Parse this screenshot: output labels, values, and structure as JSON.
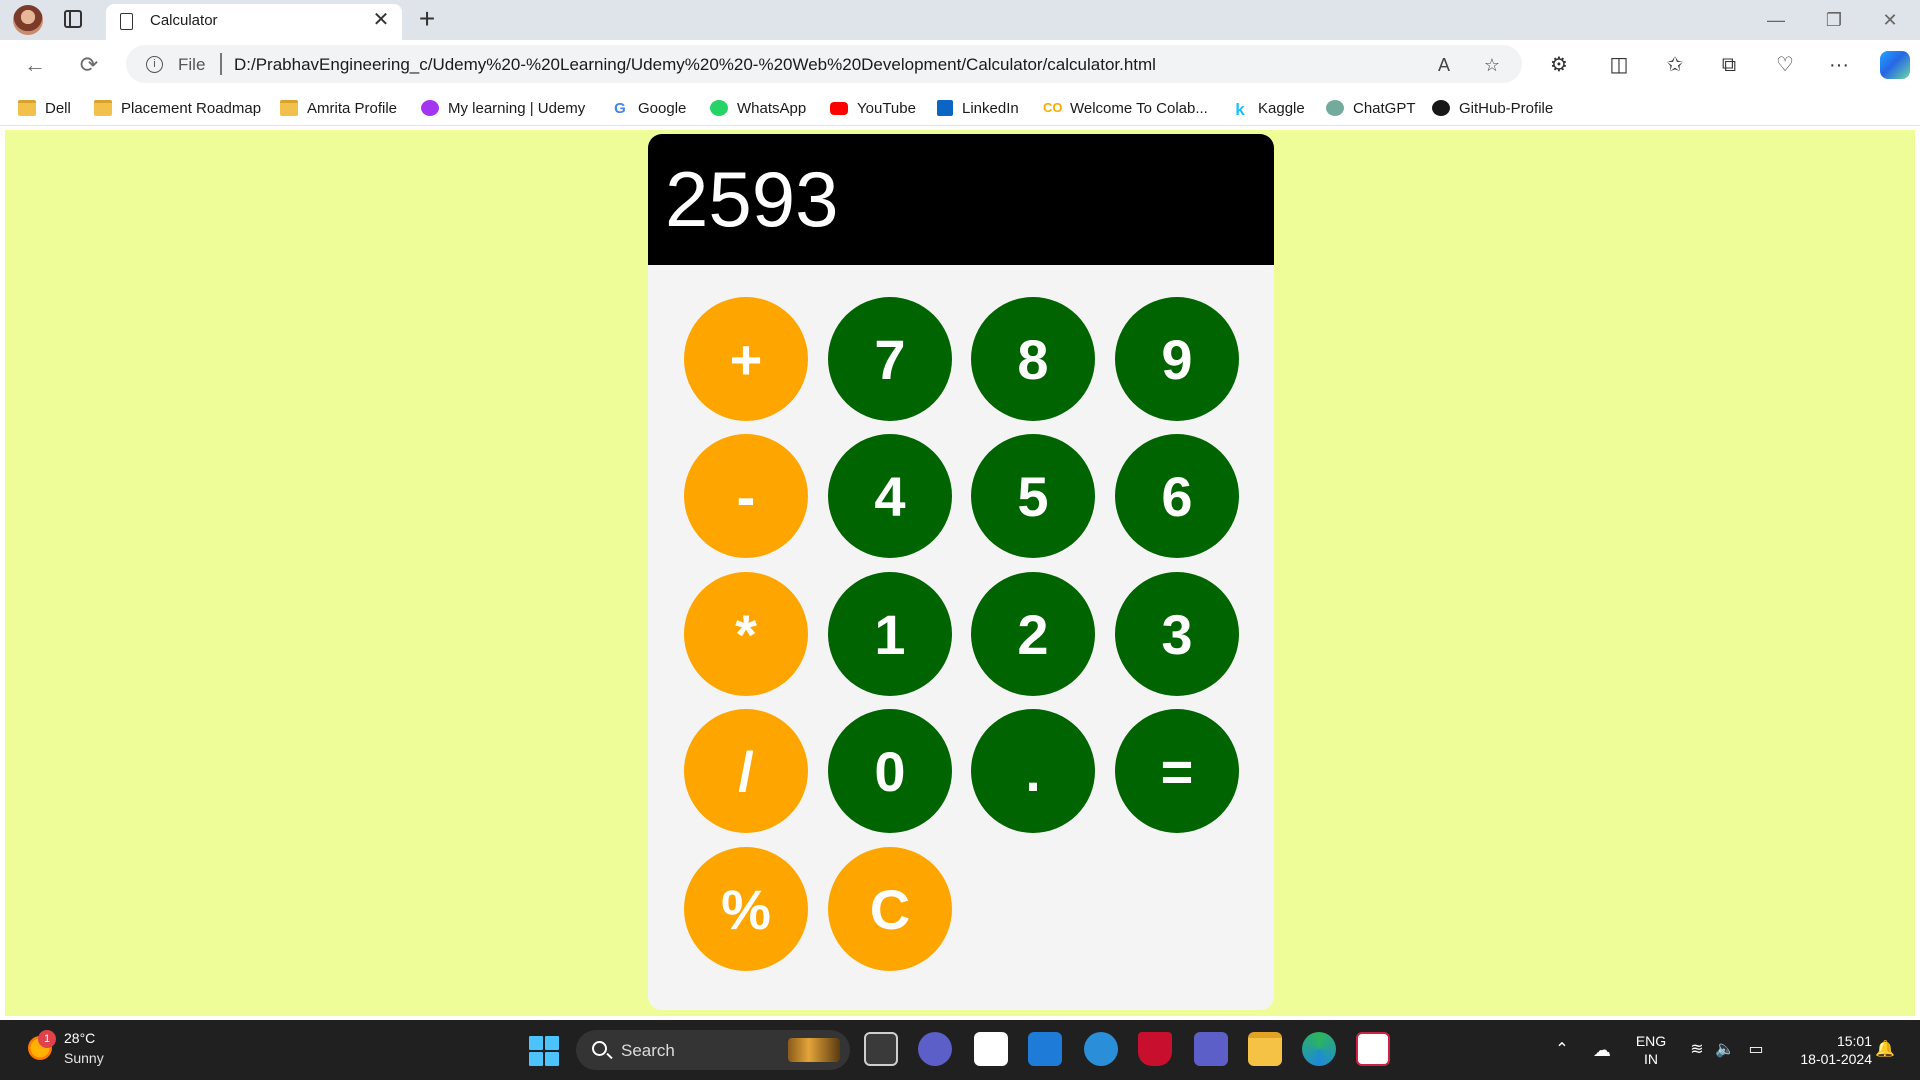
{
  "browser": {
    "tab_title": "Calculator",
    "tab_close": "✕",
    "new_tab": "+",
    "window_controls": {
      "minimize": "—",
      "restore": "❐",
      "close": "✕"
    },
    "nav": {
      "back": "←",
      "refresh": "⟳"
    },
    "address": {
      "scheme": "File",
      "url": "D:/PrabhavEngineering_c/Udemy%20-%20Learning/Udemy%20%20-%20Web%20Development/Calculator/calculator.html"
    },
    "address_icons": {
      "read_aloud": "A",
      "favorite": "☆"
    },
    "toolbar": {
      "extensions": "⚙",
      "split_screen": "◫",
      "favorites": "✩",
      "collections": "⧉",
      "performance": "♡",
      "more": "···"
    }
  },
  "bookmarks": [
    {
      "label": "Dell",
      "icon": "folder-icon",
      "color": "#f2c14b"
    },
    {
      "label": "Placement Roadmap",
      "icon": "folder-icon",
      "color": "#f2c14b"
    },
    {
      "label": "Amrita Profile",
      "icon": "folder-icon",
      "color": "#f2c14b"
    },
    {
      "label": "My learning | Udemy",
      "icon": "udemy-icon",
      "color": "#a435f0"
    },
    {
      "label": "Google",
      "icon": "google-icon",
      "color": "#4285f4"
    },
    {
      "label": "WhatsApp",
      "icon": "whatsapp-icon",
      "color": "#25d366"
    },
    {
      "label": "YouTube",
      "icon": "youtube-icon",
      "color": "#ff0000"
    },
    {
      "label": "LinkedIn",
      "icon": "linkedin-icon",
      "color": "#0a66c2"
    },
    {
      "label": "Welcome To Colab...",
      "icon": "colab-icon",
      "color": "#f9ab00"
    },
    {
      "label": "Kaggle",
      "icon": "kaggle-icon",
      "color": "#20beff"
    },
    {
      "label": "ChatGPT",
      "icon": "chatgpt-icon",
      "color": "#74aa9c"
    },
    {
      "label": "GitHub-Profile",
      "icon": "github-icon",
      "color": "#181717"
    }
  ],
  "calculator": {
    "display": "2593",
    "colors": {
      "operator": "#ffa500",
      "number": "#006400",
      "display_bg": "#000000",
      "page_bg": "#eefd98"
    },
    "keys": [
      "+",
      "7",
      "8",
      "9",
      "-",
      "4",
      "5",
      "6",
      "*",
      "1",
      "2",
      "3",
      "/",
      "0",
      ".",
      "=",
      "%",
      "C"
    ]
  },
  "taskbar": {
    "weather": {
      "temp": "28°C",
      "condition": "Sunny",
      "badge": "1"
    },
    "search_label": "Search",
    "tray": {
      "lang_top": "ENG",
      "lang_bottom": "IN",
      "time": "15:01",
      "date": "18-01-2024"
    }
  }
}
